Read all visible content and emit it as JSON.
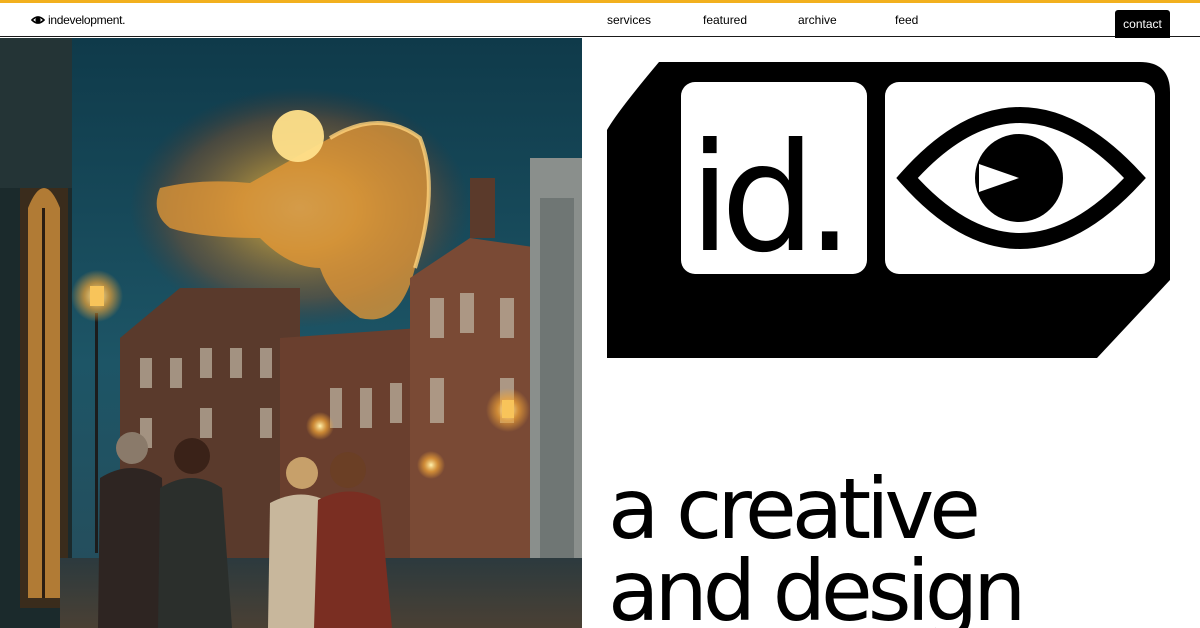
{
  "header": {
    "brand_icon": "eye-icon",
    "brand_name": "indevelopment.",
    "nav": [
      {
        "label": "services"
      },
      {
        "label": "featured"
      },
      {
        "label": "archive"
      },
      {
        "label": "feed"
      }
    ],
    "contact_label": "contact"
  },
  "logo": {
    "monogram": "id.",
    "symbol_icon": "eye-icon"
  },
  "hero": {
    "tagline_line1": "a creative",
    "tagline_line2": "and design"
  },
  "colors": {
    "accent": "#f2b01e",
    "ink": "#000000",
    "background": "#ffffff"
  }
}
